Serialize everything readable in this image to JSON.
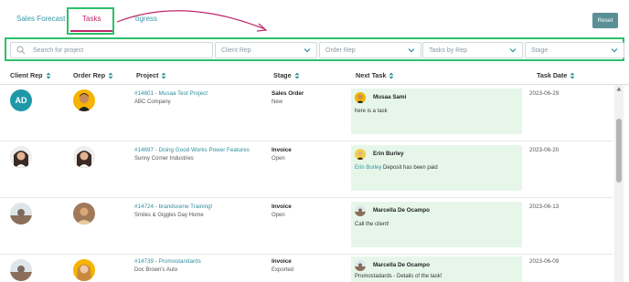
{
  "tabs": {
    "sales_forecast": "Sales Forecast",
    "tasks": "Tasks",
    "progress": "Progress"
  },
  "reset_label": "Reset",
  "filters": {
    "search_placeholder": "Search for project",
    "client_rep": "Client Rep",
    "order_rep": "Order Rep",
    "tasks_by_rep": "Tasks by Rep",
    "stage": "Stage"
  },
  "table": {
    "headers": {
      "client_rep": "Client Rep",
      "order_rep": "Order Rep",
      "project": "Project",
      "stage": "Stage",
      "next_task": "Next Task",
      "task_date": "Task Date"
    },
    "rows": [
      {
        "client_rep_initials": "AD",
        "project_link": "#14801 - Musaa Test Project",
        "project_client": "ABC Company",
        "stage": "Sales Order",
        "stage_status": "New",
        "task_assignee": "Musaa Sami",
        "task_prefix": "",
        "task_text": "here is a task",
        "task_date": "2023-06-29"
      },
      {
        "client_rep_initials": "",
        "project_link": "#14697 - Doing Good Works Power Features",
        "project_client": "Sunny Corner Industries",
        "stage": "Invoice",
        "stage_status": "Open",
        "task_assignee": "Erin Burley",
        "task_prefix": "Erin Burley",
        "task_text": " Deposit has been paid",
        "task_date": "2023-06-20"
      },
      {
        "client_rep_initials": "",
        "project_link": "#14724 - brandscene Training!",
        "project_client": "Smiles & Giggles Day Home",
        "stage": "Invoice",
        "stage_status": "Open",
        "task_assignee": "Marcella De Ocampo",
        "task_prefix": "",
        "task_text": "Call the client!",
        "task_date": "2023-06-13"
      },
      {
        "client_rep_initials": "",
        "project_link": "#14739 - Promostandards",
        "project_client": "Doc Brown's Auto",
        "stage": "Invoice",
        "stage_status": "Exported",
        "task_assignee": "Marcella De Ocampo",
        "task_prefix": "",
        "task_text": "Promostadards - Details of the task!",
        "task_date": "2023-06-09"
      }
    ]
  },
  "colors": {
    "accent_teal": "#2f8f9c",
    "active_tab": "#c0276a",
    "highlight_green": "#2dbf6a",
    "task_card_bg": "#e6f7ea"
  }
}
